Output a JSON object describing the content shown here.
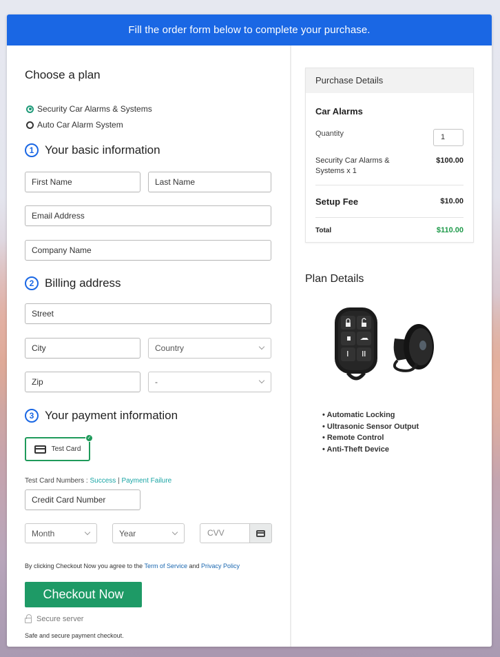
{
  "banner": {
    "text": "Fill the order form below to complete your purchase."
  },
  "plan": {
    "heading": "Choose a plan",
    "options": [
      {
        "label": "Security Car Alarms & Systems",
        "selected": true
      },
      {
        "label": "Auto Car Alarm System",
        "selected": false
      }
    ]
  },
  "basic_info": {
    "step": "1",
    "heading": "Your basic information",
    "first_name_placeholder": "First Name",
    "last_name_placeholder": "Last Name",
    "email_placeholder": "Email Address",
    "company_placeholder": "Company Name"
  },
  "billing": {
    "step": "2",
    "heading": "Billing address",
    "street_placeholder": "Street",
    "city_placeholder": "City",
    "country_selected": "Country",
    "zip_placeholder": "Zip",
    "state_selected": "-"
  },
  "payment": {
    "step": "3",
    "heading": "Your payment information",
    "method_label": "Test Card",
    "test_numbers_label": "Test Card Numbers : ",
    "success_link": "Success",
    "separator": " | ",
    "failure_link": "Payment Failure",
    "card_number_placeholder": "Credit Card Number",
    "month_selected": "Month",
    "year_selected": "Year",
    "cvv_placeholder": "CVV"
  },
  "agreement": {
    "prefix": "By clicking Checkout Now you agree to the ",
    "terms_link": "Term of Service",
    "and": " and ",
    "privacy_link": "Privacy Policy"
  },
  "checkout_button": "Checkout Now",
  "secure_server": "Secure server",
  "safe_text": "Safe and secure payment checkout.",
  "purchase": {
    "heading": "Purchase Details",
    "product": "Car Alarms",
    "quantity_label": "Quantity",
    "quantity_value": "1",
    "item_label": "Security Car Alarms & Systems x 1",
    "item_price": "$100.00",
    "setup_label": "Setup Fee",
    "setup_price": "$10.00",
    "total_label": "Total",
    "total_price": "$110.00"
  },
  "plan_details": {
    "heading": "Plan Details",
    "image_alt": "car-alarm-remote-and-siren",
    "features": [
      "Automatic Locking",
      "Ultrasonic Sensor Output",
      "Remote Control",
      "Anti-Theft Device"
    ]
  },
  "colors": {
    "banner": "#1a67e4",
    "accent_green": "#1e9a66",
    "total_green": "#1e9a4a",
    "link_teal": "#19a5a5",
    "link_blue": "#1a67b0"
  }
}
